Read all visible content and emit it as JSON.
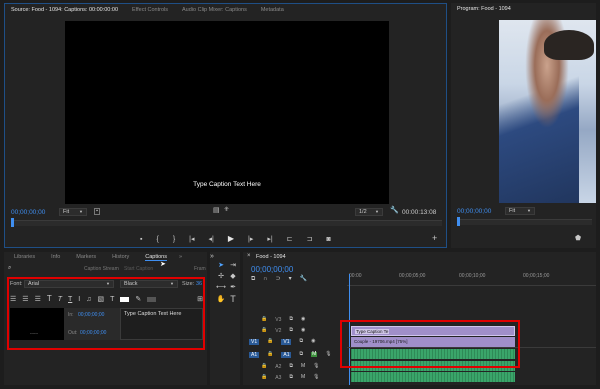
{
  "source": {
    "tabs": [
      "Source: Food - 1094: Captions: 00:00:00:00",
      "Effect Controls",
      "Audio Clip Mixer: Captions",
      "Metadata"
    ],
    "caption_text": "Type Caption Text Here",
    "timecode_left": "00;00;00;00",
    "fit": "Fit",
    "resolution": "1/2",
    "timecode_right": "00:00:13:08"
  },
  "program": {
    "title": "Program: Food - 1094",
    "timecode": "00;00;00;00",
    "fit": "Fit"
  },
  "captions_panel": {
    "tabs": [
      "Libraries",
      "Info",
      "Markers",
      "History",
      "Captions",
      "»"
    ],
    "active_tab": "Captions",
    "subrow": [
      "Caption Stream",
      "Start Caption",
      "Fram"
    ],
    "font_label": "Font:",
    "font_value": "Arial",
    "style_value": "Black",
    "size_label": "Size:",
    "size_value": "36",
    "in_label": "In:",
    "in_time": "00;00;00;00",
    "out_label": "Out:",
    "out_time": "00;00;00;00",
    "text": "Type Caption Text Here",
    "thumb_text": "------"
  },
  "timeline": {
    "title": "Food - 1094",
    "timecode": "00;00;00;00",
    "ruler": [
      "00:00",
      "00;00;05;00",
      "00;00;10;00",
      "00;00;15;00"
    ],
    "tracks_video": [
      "V3",
      "V2",
      "V1"
    ],
    "tracks_audio": [
      "A1",
      "A2",
      "A3"
    ],
    "source_patch_v": "V1",
    "source_patch_a": "A1",
    "caption_clip": "Type Caption Te",
    "video_clip": "Couple - 19706.mp4 [75%]"
  }
}
